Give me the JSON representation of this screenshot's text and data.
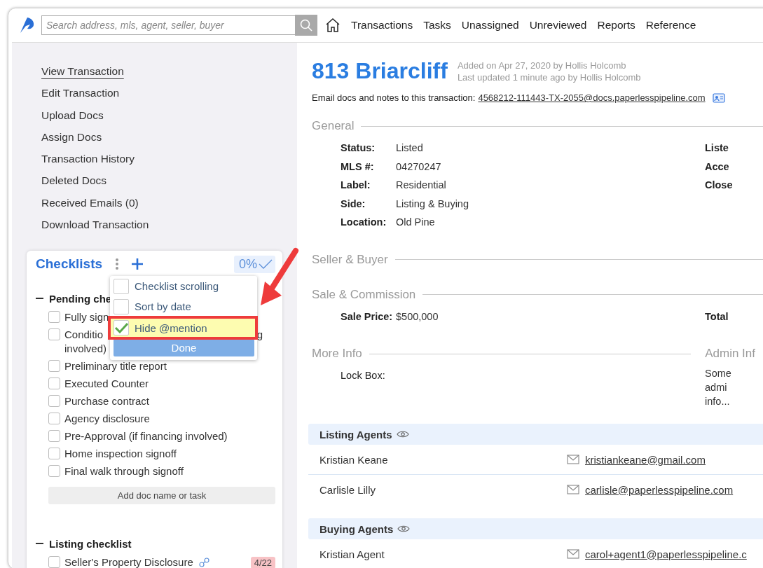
{
  "header": {
    "search_placeholder": "Search address, mls, agent, seller, buyer",
    "nav": [
      "Transactions",
      "Tasks",
      "Unassigned",
      "Unreviewed",
      "Reports",
      "Reference"
    ]
  },
  "sidebar": {
    "links": [
      {
        "label": "View Transaction",
        "selected": true
      },
      {
        "label": "Edit Transaction",
        "selected": false
      },
      {
        "label": "Upload Docs",
        "selected": false
      },
      {
        "label": "Assign Docs",
        "selected": false
      },
      {
        "label": "Transaction History",
        "selected": false
      },
      {
        "label": "Deleted Docs",
        "selected": false
      },
      {
        "label": "Received Emails (0)",
        "selected": false
      },
      {
        "label": "Download Transaction",
        "selected": false
      }
    ]
  },
  "checklists": {
    "title": "Checklists",
    "progress": "0%",
    "menu": {
      "options": [
        {
          "label": "Checklist scrolling",
          "checked": false,
          "highlighted": false
        },
        {
          "label": "Sort by date",
          "checked": false,
          "highlighted": false
        },
        {
          "label": "Hide @mention",
          "checked": true,
          "highlighted": true
        }
      ],
      "done": "Done"
    },
    "groups": [
      {
        "title": "Pending che",
        "items": [
          {
            "lines": [
              "Fully sign"
            ],
            "checked": false
          },
          {
            "lines": [
              "Conditio",
              "involved)"
            ],
            "tail": "g",
            "checked": false
          },
          {
            "lines": [
              "Preliminary title report"
            ],
            "checked": false
          },
          {
            "lines": [
              "Executed Counter"
            ],
            "checked": false
          },
          {
            "lines": [
              "Purchase contract"
            ],
            "checked": false
          },
          {
            "lines": [
              "Agency disclosure"
            ],
            "checked": false
          },
          {
            "lines": [
              "Pre-Approval (if financing involved)"
            ],
            "checked": false
          },
          {
            "lines": [
              "Home inspection signoff"
            ],
            "checked": false
          },
          {
            "lines": [
              "Final walk through signoff"
            ],
            "checked": false
          }
        ],
        "add_button": "Add doc name or task"
      },
      {
        "title": "Listing checklist",
        "items": [
          {
            "lines": [
              "Seller's Property Disclosure"
            ],
            "checked": false,
            "linked": true,
            "badge": "4/22"
          }
        ]
      }
    ]
  },
  "transaction": {
    "title": "813 Briarcliff",
    "added": "Added on Apr 27, 2020 by Hollis Holcomb",
    "updated": "Last updated 1 minute ago by Hollis Holcomb",
    "email_label": "Email docs and notes to this transaction:",
    "email": "4568212-111443-TX-2055@docs.paperlesspipeline.com"
  },
  "sections": [
    {
      "title": "General",
      "fields": [
        {
          "label": "Status:",
          "value": "Listed"
        },
        {
          "label": "MLS #:",
          "value": "04270247"
        },
        {
          "label": "Label:",
          "value": "Residential"
        },
        {
          "label": "Side:",
          "value": "Listing & Buying"
        },
        {
          "label": "Location:",
          "value": "Old Pine"
        }
      ],
      "right_labels": [
        "Liste",
        "Acce",
        "Close"
      ]
    },
    {
      "title": "Seller & Buyer"
    },
    {
      "title": "Sale & Commission",
      "fields": [
        {
          "label": "Sale Price:",
          "value": "$500,000"
        }
      ],
      "right_labels": [
        "Total"
      ]
    },
    {
      "title": "More Info",
      "fields": [
        {
          "label": "Lock Box:"
        }
      ],
      "side_title": "Admin Inf",
      "side_lines": [
        "Some",
        "admi",
        "info..."
      ]
    }
  ],
  "agent_groups": [
    {
      "title": "Listing Agents",
      "agents": [
        {
          "name": "Kristian Keane",
          "email": "kristiankeane@gmail.com"
        },
        {
          "name": "Carlisle Lilly",
          "email": "carlisle@paperlesspipeline.com"
        }
      ]
    },
    {
      "title": "Buying Agents",
      "agents": [
        {
          "name": "Kristian Agent",
          "email": "carol+agent1@paperlesspipeline.c"
        }
      ]
    }
  ]
}
